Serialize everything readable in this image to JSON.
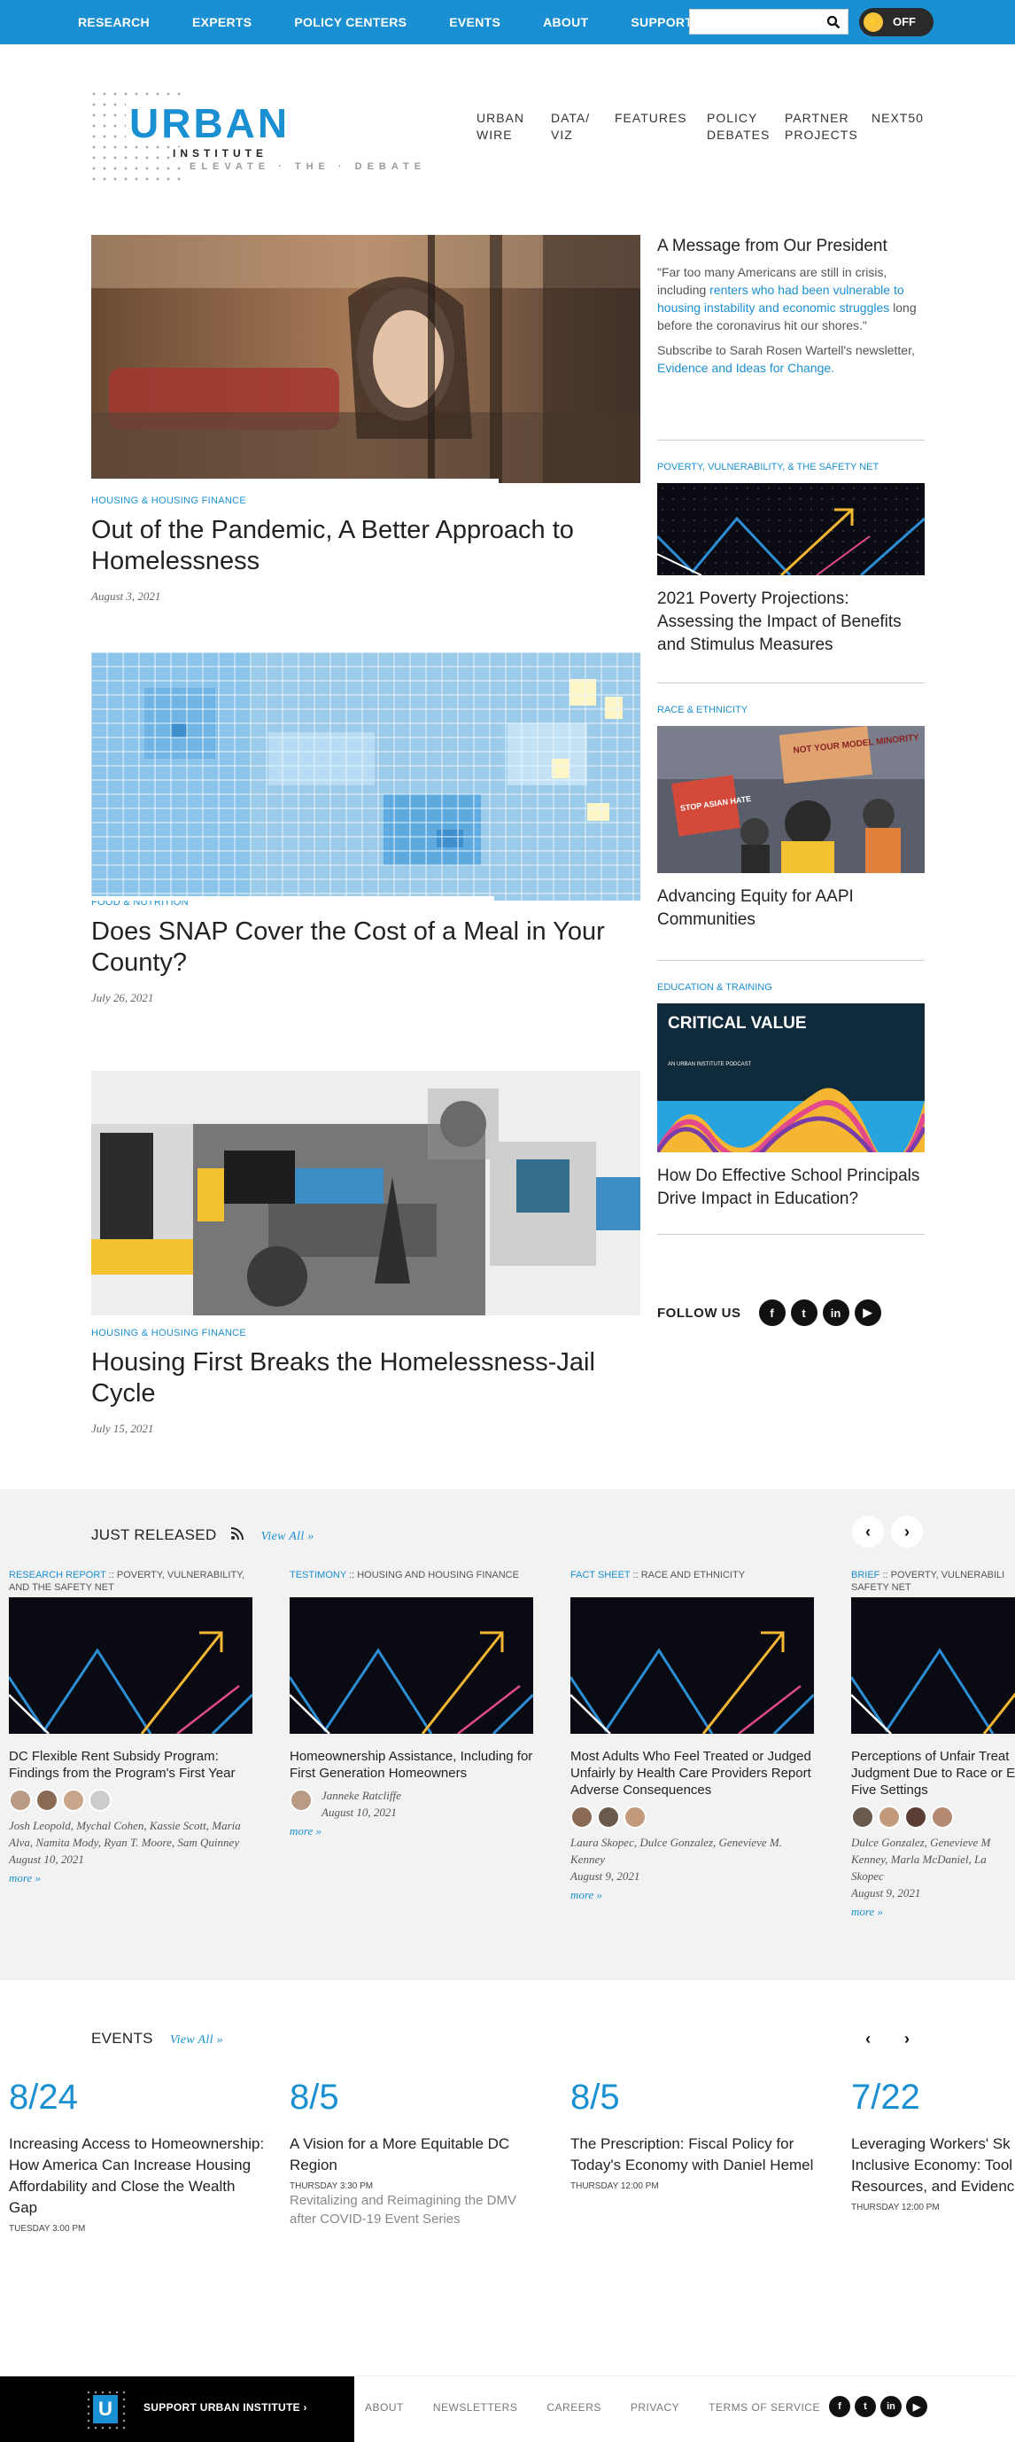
{
  "topnav": {
    "items": [
      "RESEARCH",
      "EXPERTS",
      "POLICY CENTERS",
      "EVENTS",
      "ABOUT",
      "SUPPORT"
    ],
    "search_placeholder": "",
    "toggle_label": "OFF"
  },
  "logo": {
    "name": "URBAN",
    "sub": "INSTITUTE",
    "tagline": "ELEVATE · THE · DEBATE"
  },
  "mainnav": [
    "URBAN WIRE",
    "DATA/ VIZ",
    "FEATURES",
    "POLICY DEBATES",
    "PARTNER PROJECTS",
    "NEXT50"
  ],
  "features": [
    {
      "category": "HOUSING & HOUSING FINANCE",
      "title": "Out of the Pandemic, A Better Approach to Homelessness",
      "date": "August 3, 2021"
    },
    {
      "category": "FOOD & NUTRITION",
      "title": "Does SNAP Cover the Cost of a Meal in Your County?",
      "date": "July 26, 2021"
    },
    {
      "category": "HOUSING & HOUSING FINANCE",
      "title": "Housing First Breaks the Homelessness-Jail Cycle",
      "date": "July 15, 2021"
    }
  ],
  "president": {
    "heading": "A Message from Our President",
    "quote_start": "\"Far too many Americans are still in crisis, including ",
    "quote_link": "renters who had been vulnerable to housing instability and economic struggles",
    "quote_end": " long before the coronavirus hit our shores.\"",
    "subscribe_text": "Subscribe to Sarah Rosen Wartell's newsletter, ",
    "subscribe_link": "Evidence and Ideas for Change."
  },
  "sidebar": [
    {
      "category": "POVERTY, VULNERABILITY, & THE SAFETY NET",
      "title": "2021 Poverty Projections: Assessing the Impact of Benefits and Stimulus Measures"
    },
    {
      "category": "RACE & ETHNICITY",
      "title": "Advancing Equity for AAPI Communities",
      "sign_top": "NOT YOUR MODEL MINORITY",
      "sign_left": "STOP ASIAN HATE"
    },
    {
      "category": "EDUCATION & TRAINING",
      "title": "How Do Effective School Principals Drive Impact in Education?",
      "podcast_title": "CRITICAL VALUE",
      "podcast_sub": "AN URBAN INSTITUTE PODCAST"
    }
  ],
  "follow": {
    "label": "FOLLOW US",
    "icons": [
      "f",
      "t",
      "in",
      "▶"
    ]
  },
  "just_released": {
    "heading": "JUST RELEASED",
    "view_all": "View All »",
    "cards": [
      {
        "type": "RESEARCH REPORT",
        "topic": "POVERTY, VULNERABILITY, AND THE SAFETY NET",
        "title": "DC Flexible Rent Subsidy Program: Findings from the Program's First Year",
        "authors": "Josh Leopold, Mychal Cohen, Kassie Scott, Maria Alva, Namita Mody, Ryan T. Moore, Sam Quinney",
        "date": "August 10, 2021",
        "more": "more »"
      },
      {
        "type": "TESTIMONY",
        "topic": "HOUSING AND HOUSING FINANCE",
        "title": "Homeownership Assistance, Including for First Generation Homeowners",
        "authors": "Janneke Ratcliffe",
        "date": "August 10, 2021",
        "more": "more »"
      },
      {
        "type": "FACT SHEET",
        "topic": "RACE AND ETHNICITY",
        "title": "Most Adults Who Feel Treated or Judged Unfairly by Health Care Providers Report Adverse Consequences",
        "authors": "Laura Skopec, Dulce Gonzalez, Genevieve M. Kenney",
        "date": "August 9, 2021",
        "more": "more »"
      },
      {
        "type": "BRIEF",
        "topic": "POVERTY, VULNERABILI SAFETY NET",
        "title": "Perceptions of Unfair Treat Judgment Due to Race or E Five Settings",
        "authors": "Dulce Gonzalez, Genevieve M Kenney, Marla McDaniel, La Skopec",
        "date": "August 9, 2021",
        "more": "more »"
      }
    ]
  },
  "events": {
    "heading": "EVENTS",
    "view_all": "View All »",
    "items": [
      {
        "date": "8/24",
        "title": "Increasing Access to Homeownership: How America Can Increase Housing Affordability and Close the Wealth Gap",
        "time": "TUESDAY 3:00 PM",
        "sub": ""
      },
      {
        "date": "8/5",
        "title": "A Vision for a More Equitable DC Region",
        "time": "THURSDAY 3:30 PM",
        "sub": "Revitalizing and Reimagining the DMV after COVID-19 Event Series"
      },
      {
        "date": "8/5",
        "title": "The Prescription: Fiscal Policy for Today's Economy with Daniel Hemel",
        "time": "THURSDAY 12:00 PM",
        "sub": ""
      },
      {
        "date": "7/22",
        "title": "Leveraging Workers' Sk Inclusive Economy: Tool Resources, and Evidence",
        "time": "THURSDAY 12:00 PM",
        "sub": ""
      }
    ]
  },
  "footer": {
    "support": "SUPPORT URBAN INSTITUTE ›",
    "links": [
      "ABOUT",
      "NEWSLETTERS",
      "CAREERS",
      "PRIVACY",
      "TERMS OF SERVICE"
    ]
  },
  "colors": {
    "brand": "#1a8fd1",
    "dark": "#222222",
    "panel": "#f2f2f2"
  }
}
